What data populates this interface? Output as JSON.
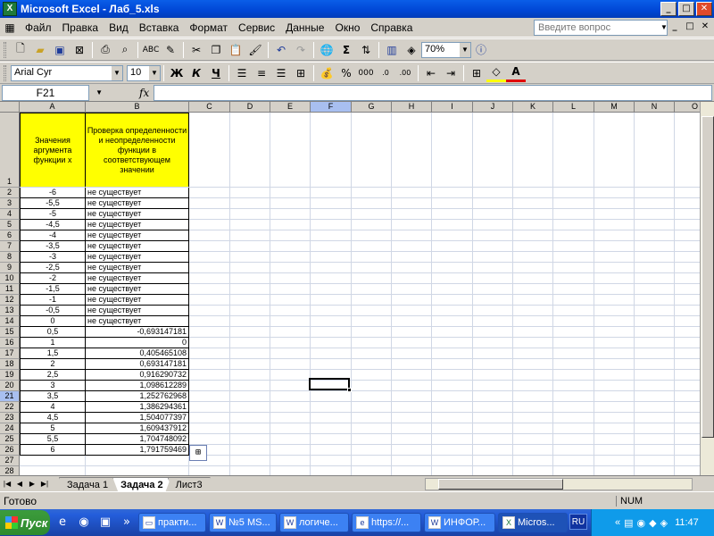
{
  "window": {
    "title": "Microsoft Excel - Лаб_5.xls",
    "app_icon": "X",
    "btn_min": "_",
    "btn_max": "□",
    "btn_close": "✕"
  },
  "menu": [
    "Файл",
    "Правка",
    "Вид",
    "Вставка",
    "Формат",
    "Сервис",
    "Данные",
    "Окно",
    "Справка"
  ],
  "help": {
    "placeholder": "Введите вопрос"
  },
  "toolbar": {
    "zoom": "70%",
    "font": "Arial Cyr",
    "size": "10",
    "bold": "Ж",
    "italic": "К",
    "underline": "Ч",
    "percent": "%",
    "thousands": "000",
    "sigma": "Σ"
  },
  "formula": {
    "cell_ref": "F21",
    "fx": "fx",
    "value": ""
  },
  "columns": [
    "A",
    "B",
    "C",
    "D",
    "E",
    "F",
    "G",
    "H",
    "I",
    "J",
    "K",
    "L",
    "M",
    "N",
    "O"
  ],
  "header_a": "Значения аргумента функции х",
  "header_b": "Проверка определенности и неопределенности функции в соответствующем значении",
  "rows": [
    {
      "n": "2",
      "a": "-6",
      "b": "не существует"
    },
    {
      "n": "3",
      "a": "-5,5",
      "b": "не существует"
    },
    {
      "n": "4",
      "a": "-5",
      "b": "не существует"
    },
    {
      "n": "5",
      "a": "-4,5",
      "b": "не существует"
    },
    {
      "n": "6",
      "a": "-4",
      "b": "не существует"
    },
    {
      "n": "7",
      "a": "-3,5",
      "b": "не существует"
    },
    {
      "n": "8",
      "a": "-3",
      "b": "не существует"
    },
    {
      "n": "9",
      "a": "-2,5",
      "b": "не существует"
    },
    {
      "n": "10",
      "a": "-2",
      "b": "не существует"
    },
    {
      "n": "11",
      "a": "-1,5",
      "b": "не существует"
    },
    {
      "n": "12",
      "a": "-1",
      "b": "не существует"
    },
    {
      "n": "13",
      "a": "-0,5",
      "b": "не существует"
    },
    {
      "n": "14",
      "a": "0",
      "b": "не существует"
    },
    {
      "n": "15",
      "a": "0,5",
      "b": "-0,693147181"
    },
    {
      "n": "16",
      "a": "1",
      "b": "0"
    },
    {
      "n": "17",
      "a": "1,5",
      "b": "0,405465108"
    },
    {
      "n": "18",
      "a": "2",
      "b": "0,693147181"
    },
    {
      "n": "19",
      "a": "2,5",
      "b": "0,916290732"
    },
    {
      "n": "20",
      "a": "3",
      "b": "1,098612289"
    },
    {
      "n": "21",
      "a": "3,5",
      "b": "1,252762968"
    },
    {
      "n": "22",
      "a": "4",
      "b": "1,386294361"
    },
    {
      "n": "23",
      "a": "4,5",
      "b": "1,504077397"
    },
    {
      "n": "24",
      "a": "5",
      "b": "1,609437912"
    },
    {
      "n": "25",
      "a": "5,5",
      "b": "1,704748092"
    },
    {
      "n": "26",
      "a": "6",
      "b": "1,791759469"
    }
  ],
  "empty_rows": [
    "27",
    "28",
    "29"
  ],
  "row1": "1",
  "sheets": [
    "Задача 1",
    "Задача 2",
    "Лист3"
  ],
  "active_sheet": 1,
  "status": {
    "text": "Готово",
    "num": "NUM"
  },
  "taskbar": {
    "start": "Пуск",
    "more": "»",
    "tasks": [
      "практи...",
      "№5 MS...",
      "логиче...",
      "https://...",
      "ИНФОР...",
      "Micros..."
    ],
    "lang": "RU",
    "tray_more": "«",
    "clock": "11:47"
  }
}
